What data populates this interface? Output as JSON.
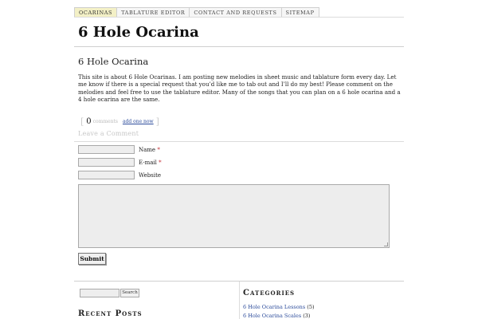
{
  "nav": {
    "tabs": [
      {
        "label": "Ocarinas",
        "active": true
      },
      {
        "label": "Tablature Editor",
        "active": false
      },
      {
        "label": "Contact and Requests",
        "active": false
      },
      {
        "label": "Sitemap",
        "active": false
      }
    ]
  },
  "site": {
    "title": "6 Hole Ocarina"
  },
  "page": {
    "heading": "6 Hole Ocarina",
    "intro": "This site is about 6 Hole Ocarinas. I am posting new melodies in sheet music and tablature form every day. Let me know if there is a special request that you’d like me to tab out and I’ll do my best! Please comment on the melodies and feel free to use the tablature editor. Many of the songs that you can plan on a 6 hole ocarina and a 4 hole ocarina are the same."
  },
  "comments": {
    "count": "0",
    "count_label": "comments",
    "add_link": "add one now",
    "leave_heading": "Leave a Comment"
  },
  "form": {
    "name_label": "Name",
    "email_label": "E-mail",
    "website_label": "Website",
    "required_mark": "*",
    "submit_label": "Submit"
  },
  "sidebar": {
    "search_button": "Search",
    "recent_posts_heading": "Recent Posts",
    "categories_heading": "Categories",
    "categories": [
      {
        "name": "6 Hole Ocarina Lessons",
        "count": "(5)"
      },
      {
        "name": "6 Hole Ocarina Scales",
        "count": "(3)"
      }
    ]
  },
  "colors": {
    "active_tab": "#f3f0c6",
    "link": "#2a4a9a",
    "required": "#c0262c"
  }
}
